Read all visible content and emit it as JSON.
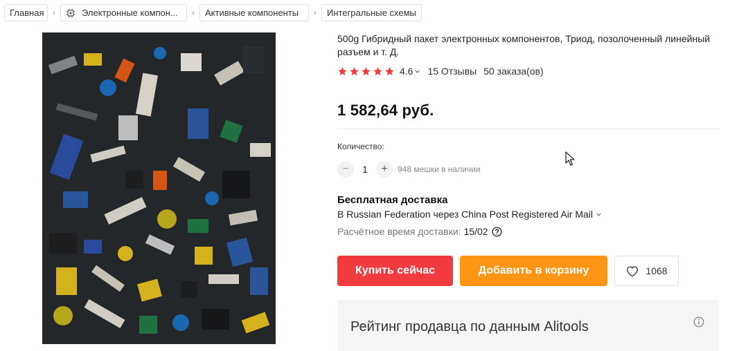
{
  "breadcrumbs": [
    {
      "label": "Главная"
    },
    {
      "label": "Электронные компон...",
      "icon": "chip-icon"
    },
    {
      "label": "Активные компоненты"
    },
    {
      "label": "Интегральные схемы"
    }
  ],
  "product": {
    "title": "500g Гибридный пакет электронных компонентов, Триод, позолоченный линейный разъем и т. Д.",
    "rating": "4.6",
    "stars": 5,
    "reviews": "15 Отзывы",
    "orders": "50 заказа(ов)",
    "price": "1 582,64 руб."
  },
  "quantity": {
    "label": "Количество:",
    "value": "1",
    "minus": "−",
    "plus": "+",
    "stock": "948 мешки в наличии"
  },
  "shipping": {
    "title": "Бесплатная доставка",
    "method": "В Russian Federation через China Post Registered Air Mail",
    "eta_label": "Расчётное время доставки:",
    "eta_date": "15/02"
  },
  "actions": {
    "buy_label": "Купить сейчас",
    "cart_label": "Добавить в корзину",
    "wishlist_count": "1068"
  },
  "seller": {
    "title": "Рейтинг продавца по данным Alitools"
  },
  "colors": {
    "buy": "#f23b3f",
    "cart": "#ff9415",
    "star": "#f23b3f"
  }
}
